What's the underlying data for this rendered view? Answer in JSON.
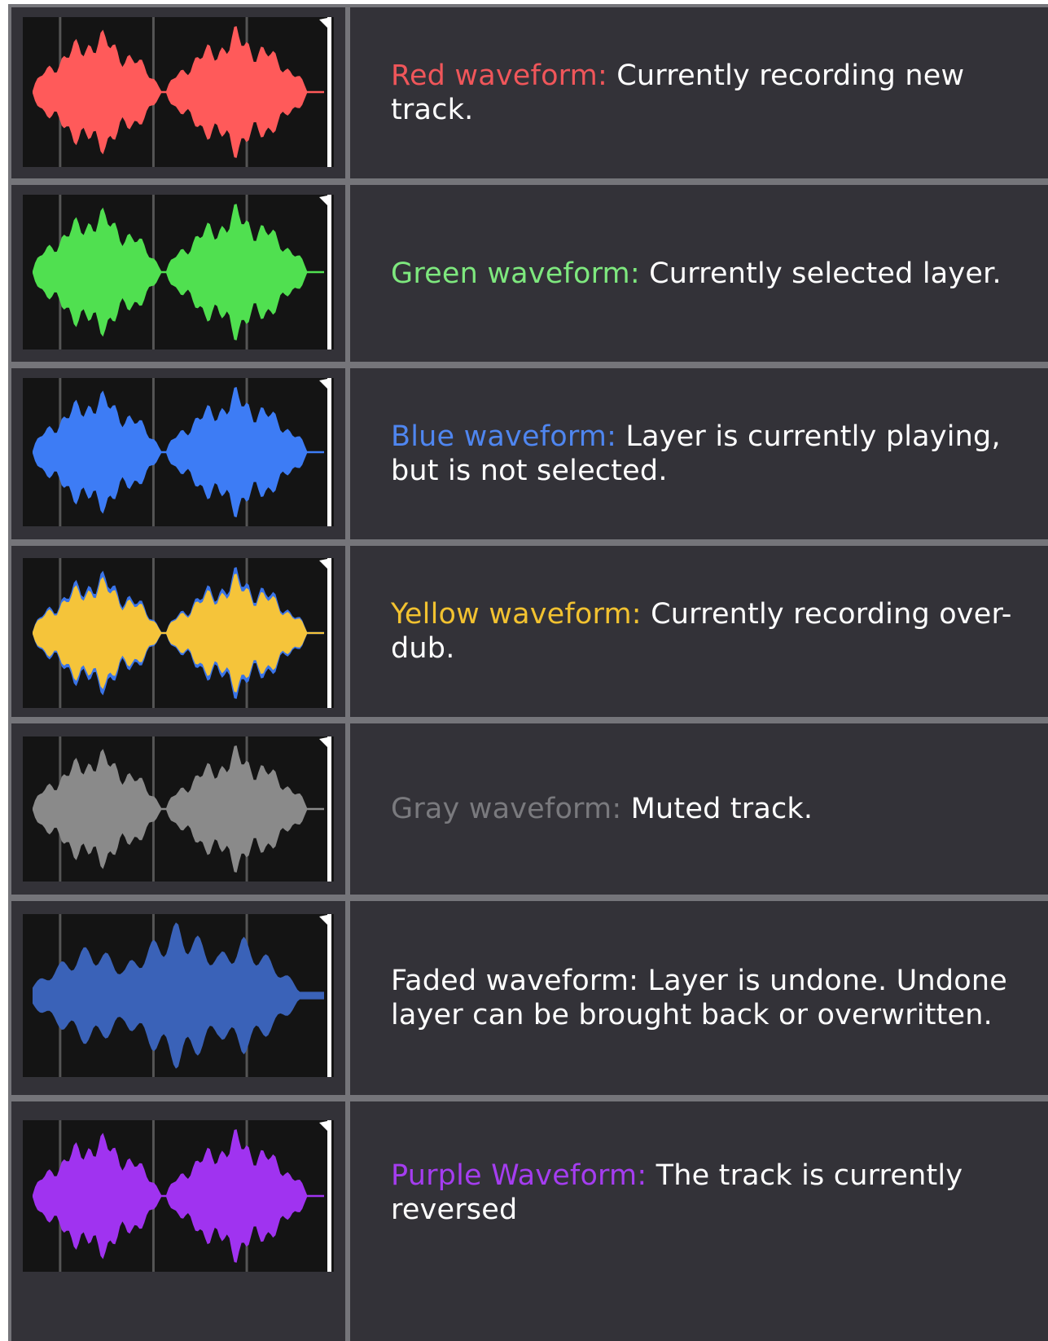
{
  "rows": [
    {
      "label": "Red waveform:",
      "text": " Currently recording new track.",
      "color": "#ff5a5a",
      "label_color": "#f0565a",
      "icon": "red-waveform-icon"
    },
    {
      "label": "Green waveform:",
      "text": " Currently selected layer.",
      "color": "#50e050",
      "label_color": "#7ee87e",
      "icon": "green-waveform-icon"
    },
    {
      "label": "Blue waveform:",
      "text": " Layer is currently playing, but is not selected.",
      "color": "#3d7cf5",
      "label_color": "#4f86f0",
      "icon": "blue-waveform-icon"
    },
    {
      "label": "Yellow waveform:",
      "text": " Currently recording over-dub.",
      "color": "#f5c43a",
      "secondary_color": "#3a74e8",
      "label_color": "#f2c230",
      "icon": "yellow-waveform-icon"
    },
    {
      "label": "Gray waveform:",
      "text": " Muted track.",
      "color": "#8a8a8a",
      "label_color": "#7a7a7e",
      "icon": "gray-waveform-icon"
    },
    {
      "label": "",
      "text": "Faded waveform: Layer is undone. Undone layer can be brought back or overwritten.",
      "color": "#3a62b8",
      "label_color": "#ffffff",
      "icon": "faded-waveform-icon"
    },
    {
      "label": "Purple Waveform:",
      "text": " The track is currently reversed",
      "color": "#a033f0",
      "label_color": "#a53df0",
      "icon": "purple-waveform-icon"
    }
  ]
}
